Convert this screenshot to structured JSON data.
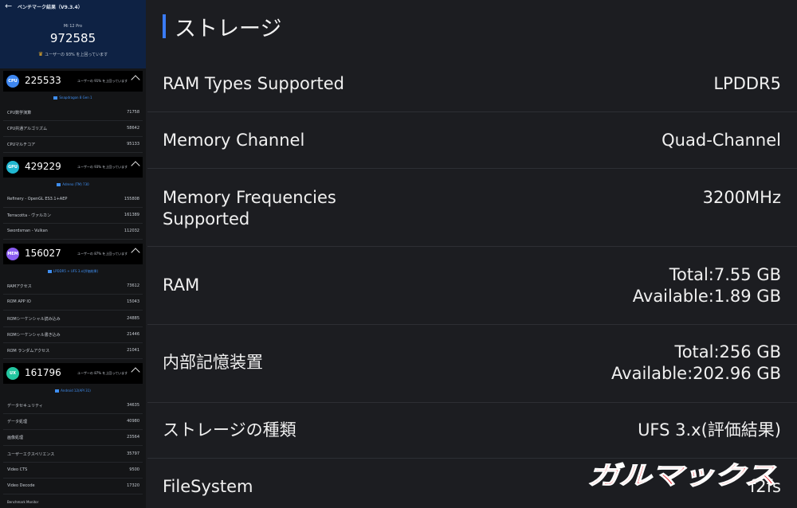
{
  "header": {
    "back_icon": "back-arrow-icon",
    "title": "ベンチマーク結果（V9.3.4）",
    "device": "Mi 12 Pro",
    "total_score": "972585",
    "rank_text": "ユーザーの 93% を上回っています",
    "crown_icon": "crown-icon"
  },
  "sections": [
    {
      "badge": "CPU",
      "color": "#3d86f0",
      "score": "225533",
      "rank": "ユーザーの 91% を上回っています",
      "chip": "Snapdragon 8 Gen 1",
      "rows": [
        {
          "label": "CPU数学演算",
          "value": "71758"
        },
        {
          "label": "CPU共通アルゴリズム",
          "value": "58642"
        },
        {
          "label": "CPUマルチコア",
          "value": "95133"
        }
      ]
    },
    {
      "badge": "GPU",
      "color": "#20b7d0",
      "score": "429229",
      "rank": "ユーザーの 93% を上回っています",
      "chip": "Adreno (TM) 730",
      "rows": [
        {
          "label": "Refinery - OpenGL ES3.1+AEP",
          "value": "155808"
        },
        {
          "label": "Terracotta - ヴァルカン",
          "value": "161389"
        },
        {
          "label": "Swordsman - Vulkan",
          "value": "112032"
        }
      ]
    },
    {
      "badge": "MEM",
      "color": "#8a5cf0",
      "score": "156027",
      "rank": "ユーザーの 87% を上回っています",
      "chip": "LPDDR5 + UFS 3.x(評価結果)",
      "rows": [
        {
          "label": "RAMアクセス",
          "value": "73612"
        },
        {
          "label": "ROM APP IO",
          "value": "15043"
        },
        {
          "label": "ROMシーケンシャル読み込み",
          "value": "24885"
        },
        {
          "label": "ROMシーケンシャル書き込み",
          "value": "21446"
        },
        {
          "label": "ROM ランダムアクセス",
          "value": "21041"
        }
      ]
    },
    {
      "badge": "UX",
      "color": "#23c6a0",
      "score": "161796",
      "rank": "ユーザーの 87% を上回っています",
      "chip": "Android 12(API 31)",
      "rows": [
        {
          "label": "データセキュリティ",
          "value": "34635"
        },
        {
          "label": "データ処理",
          "value": "40980"
        },
        {
          "label": "画像処理",
          "value": "23564"
        },
        {
          "label": "ユーザーエクスペリエンス",
          "value": "35797"
        },
        {
          "label": "Video CTS",
          "value": "9500"
        },
        {
          "label": "Video Decode",
          "value": "17320"
        }
      ]
    }
  ],
  "footer_label": "Benchmark Monitor",
  "storage": {
    "title": "ストレージ",
    "items": [
      {
        "name": "RAM Types Supported",
        "value": "LPDDR5"
      },
      {
        "name": "Memory Channel",
        "value": "Quad-Channel"
      },
      {
        "name": "Memory Frequencies Supported",
        "value": "3200MHz"
      },
      {
        "name": "RAM",
        "value": "Total:7.55 GB\nAvailable:1.89 GB"
      },
      {
        "name": "内部記憶装置",
        "value": "Total:256 GB\nAvailable:202.96 GB"
      },
      {
        "name": "ストレージの種類",
        "value": "UFS 3.x(評価結果)"
      },
      {
        "name": "FileSystem",
        "value": "f2fs"
      }
    ]
  },
  "watermark": "ガルマックス",
  "colors": {
    "accent": "#3a7bf5",
    "header_bg": "#0e2244",
    "panel_bg": "#1c1d21",
    "watermark": "#e8202a"
  }
}
